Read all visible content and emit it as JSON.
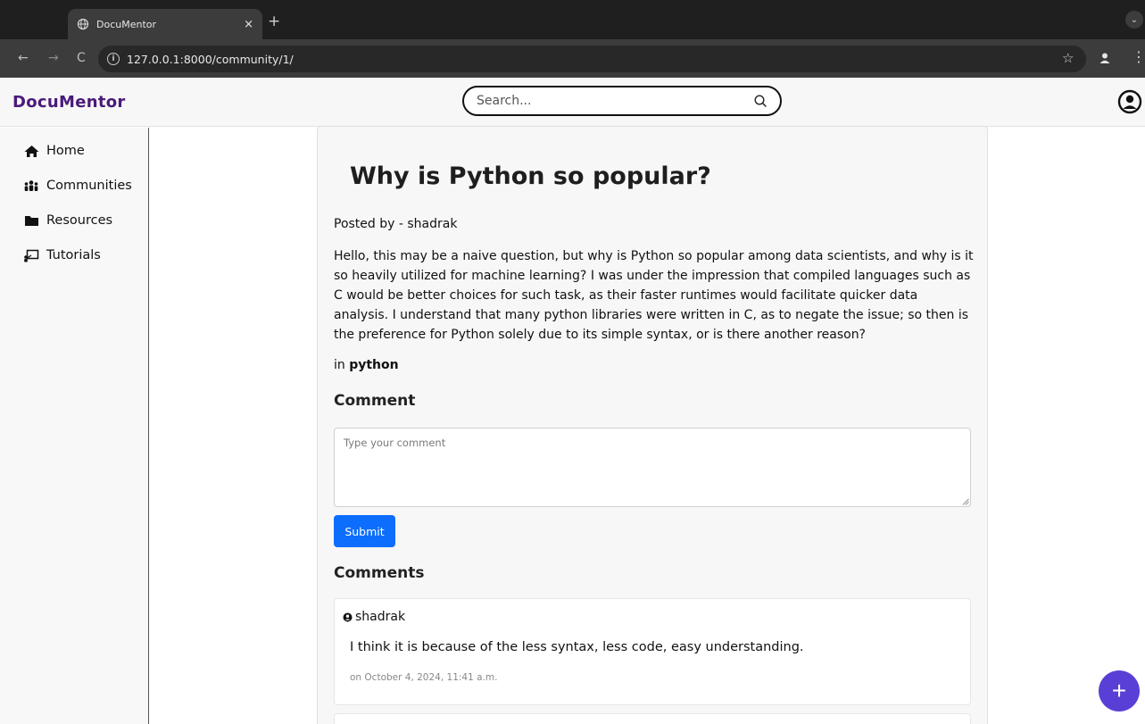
{
  "browser": {
    "tab_title": "DocuMentor",
    "tab_close": "×",
    "new_tab": "+",
    "dropdown": "⌄",
    "url": "127.0.0.1:8000/community/1/",
    "back": "←",
    "forward": "→",
    "reload": "C",
    "bookmark": "☆",
    "menu": "⋮"
  },
  "app": {
    "brand": "DocuMentor",
    "search_placeholder": "Search..."
  },
  "sidebar": {
    "items": [
      {
        "label": "Home",
        "icon": "home-icon"
      },
      {
        "label": "Communities",
        "icon": "communities-icon"
      },
      {
        "label": "Resources",
        "icon": "folder-icon"
      },
      {
        "label": "Tutorials",
        "icon": "tutorials-icon"
      }
    ]
  },
  "post": {
    "title": "Why is Python so popular?",
    "posted_by": "Posted by - shadrak",
    "body": "Hello, this may be a naive question, but why is Python so popular among data scientists, and why is it so heavily utilized for machine learning? I was under the impression that compiled languages such as C would be better choices for such task, as their faster runtimes would facilitate quicker data analysis. I understand that many python libraries were written in C, as to negate the issue; so then is the preference for Python solely due to its simple syntax, or is there another reason?",
    "in_prefix": "in",
    "community": "python"
  },
  "comment_form": {
    "heading": "Comment",
    "placeholder": "Type your comment",
    "submit_label": "Submit"
  },
  "comments": {
    "heading": "Comments",
    "items": [
      {
        "author": "shadrak",
        "text": "I think it is because of the less syntax, less code, easy understanding.",
        "date": "on October 4, 2024, 11:41 a.m."
      }
    ]
  },
  "fab": {
    "label": "+"
  },
  "colors": {
    "brand": "#4a1a7a",
    "primary": "#0d6efd",
    "fab": "#5a3fd6"
  }
}
